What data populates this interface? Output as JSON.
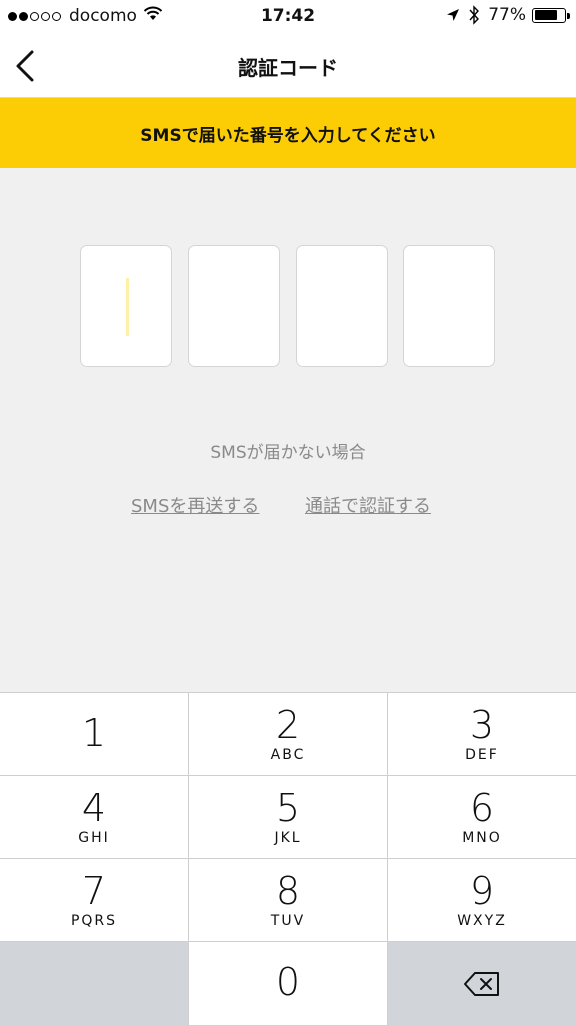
{
  "status_bar": {
    "carrier": "docomo",
    "time": "17:42",
    "battery_percent": "77%",
    "signal_dots_filled": 2,
    "signal_dots_total": 5,
    "icons": [
      "wifi-icon",
      "location-arrow-icon",
      "bluetooth-icon",
      "battery-icon"
    ]
  },
  "nav": {
    "title": "認証コード",
    "back_icon": "chevron-left-icon"
  },
  "banner": {
    "text": "SMSで届いた番号を入力してください",
    "color": "#fccd05"
  },
  "code_inputs": {
    "count": 4,
    "values": [
      "",
      "",
      "",
      ""
    ],
    "focused_index": 0
  },
  "help": {
    "no_sms_text": "SMSが届かない場合",
    "resend_link": "SMSを再送する",
    "call_link": "通話で認証する"
  },
  "keypad": {
    "keys": [
      {
        "num": "1",
        "letters": ""
      },
      {
        "num": "2",
        "letters": "ABC"
      },
      {
        "num": "3",
        "letters": "DEF"
      },
      {
        "num": "4",
        "letters": "GHI"
      },
      {
        "num": "5",
        "letters": "JKL"
      },
      {
        "num": "6",
        "letters": "MNO"
      },
      {
        "num": "7",
        "letters": "PQRS"
      },
      {
        "num": "8",
        "letters": "TUV"
      },
      {
        "num": "9",
        "letters": "WXYZ"
      },
      {
        "num": "",
        "letters": ""
      },
      {
        "num": "0",
        "letters": ""
      },
      {
        "num": "",
        "letters": "",
        "icon": "backspace-icon"
      }
    ]
  }
}
